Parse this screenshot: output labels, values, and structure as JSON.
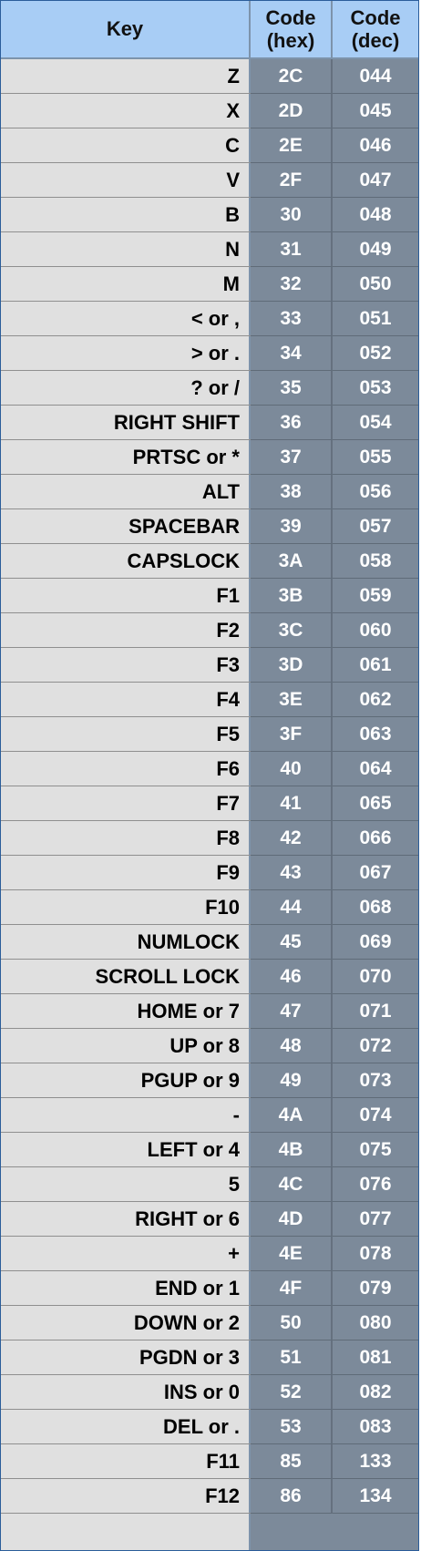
{
  "header": {
    "key_label": "Key",
    "hex_line1": "Code",
    "hex_line2": "(hex)",
    "dec_line1": "Code",
    "dec_line2": "(dec)"
  },
  "rows": [
    {
      "key": "Z",
      "hex": "2C",
      "dec": "044"
    },
    {
      "key": "X",
      "hex": "2D",
      "dec": "045"
    },
    {
      "key": "C",
      "hex": "2E",
      "dec": "046"
    },
    {
      "key": "V",
      "hex": "2F",
      "dec": "047"
    },
    {
      "key": "B",
      "hex": "30",
      "dec": "048"
    },
    {
      "key": "N",
      "hex": "31",
      "dec": "049"
    },
    {
      "key": "M",
      "hex": "32",
      "dec": "050"
    },
    {
      "key": "< or ,",
      "hex": "33",
      "dec": "051"
    },
    {
      "key": "> or .",
      "hex": "34",
      "dec": "052"
    },
    {
      "key": "? or /",
      "hex": "35",
      "dec": "053"
    },
    {
      "key": "RIGHT SHIFT",
      "hex": "36",
      "dec": "054"
    },
    {
      "key": "PRTSC or *",
      "hex": "37",
      "dec": "055"
    },
    {
      "key": "ALT",
      "hex": "38",
      "dec": "056"
    },
    {
      "key": "SPACEBAR",
      "hex": "39",
      "dec": "057"
    },
    {
      "key": "CAPSLOCK",
      "hex": "3A",
      "dec": "058"
    },
    {
      "key": "F1",
      "hex": "3B",
      "dec": "059"
    },
    {
      "key": "F2",
      "hex": "3C",
      "dec": "060"
    },
    {
      "key": "F3",
      "hex": "3D",
      "dec": "061"
    },
    {
      "key": "F4",
      "hex": "3E",
      "dec": "062"
    },
    {
      "key": "F5",
      "hex": "3F",
      "dec": "063"
    },
    {
      "key": "F6",
      "hex": "40",
      "dec": "064"
    },
    {
      "key": "F7",
      "hex": "41",
      "dec": "065"
    },
    {
      "key": "F8",
      "hex": "42",
      "dec": "066"
    },
    {
      "key": "F9",
      "hex": "43",
      "dec": "067"
    },
    {
      "key": "F10",
      "hex": "44",
      "dec": "068"
    },
    {
      "key": "NUMLOCK",
      "hex": "45",
      "dec": "069"
    },
    {
      "key": "SCROLL LOCK",
      "hex": "46",
      "dec": "070"
    },
    {
      "key": "HOME or 7",
      "hex": "47",
      "dec": "071"
    },
    {
      "key": "UP or 8",
      "hex": "48",
      "dec": "072"
    },
    {
      "key": "PGUP or 9",
      "hex": "49",
      "dec": "073"
    },
    {
      "key": "-",
      "hex": "4A",
      "dec": "074"
    },
    {
      "key": "LEFT or 4",
      "hex": "4B",
      "dec": "075"
    },
    {
      "key": "5",
      "hex": "4C",
      "dec": "076"
    },
    {
      "key": "RIGHT or 6",
      "hex": "4D",
      "dec": "077"
    },
    {
      "key": "+",
      "hex": "4E",
      "dec": "078"
    },
    {
      "key": "END or 1",
      "hex": "4F",
      "dec": "079"
    },
    {
      "key": "DOWN or 2",
      "hex": "50",
      "dec": "080"
    },
    {
      "key": "PGDN or 3",
      "hex": "51",
      "dec": "081"
    },
    {
      "key": "INS or 0",
      "hex": "52",
      "dec": "082"
    },
    {
      "key": "DEL or .",
      "hex": "53",
      "dec": "083"
    },
    {
      "key": "F11",
      "hex": "85",
      "dec": "133"
    },
    {
      "key": "F12",
      "hex": "86",
      "dec": "134"
    }
  ],
  "colors": {
    "header_bg": "#a8cdf5",
    "key_cell_bg": "#e0e0e0",
    "code_cell_bg": "#7c8a9a",
    "border": "#2b5d9a"
  }
}
